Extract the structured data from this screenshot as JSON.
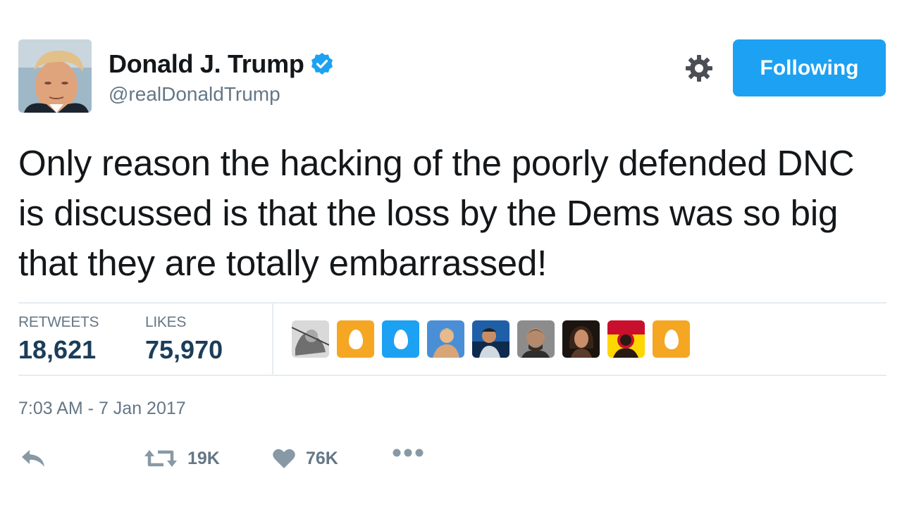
{
  "author": {
    "name": "Donald J. Trump",
    "handle": "@realDonaldTrump",
    "verified": true
  },
  "header": {
    "follow_button_label": "Following",
    "settings_icon": "gear-icon"
  },
  "tweet": {
    "text": "Only reason the hacking of the poorly defended DNC is discussed is that the loss by the Dems was so big that they are totally embarrassed!",
    "timestamp": "7:03 AM - 7 Jan 2017"
  },
  "stats": {
    "retweets_label": "RETWEETS",
    "retweets_value": "18,621",
    "likes_label": "LIKES",
    "likes_value": "75,970"
  },
  "likers": [
    {
      "type": "photo",
      "icon": "liker-avatar"
    },
    {
      "type": "egg",
      "color": "#f5a623"
    },
    {
      "type": "egg",
      "color": "#1da1f2"
    },
    {
      "type": "photo",
      "icon": "liker-avatar"
    },
    {
      "type": "photo",
      "icon": "liker-avatar"
    },
    {
      "type": "photo",
      "icon": "liker-avatar"
    },
    {
      "type": "photo",
      "icon": "liker-avatar"
    },
    {
      "type": "photo",
      "icon": "liker-avatar"
    },
    {
      "type": "egg",
      "color": "#f5a623"
    }
  ],
  "actions": {
    "reply_icon": "reply-icon",
    "retweet_count": "19K",
    "like_count": "76K",
    "more_icon": "more-icon"
  },
  "colors": {
    "accent": "#1da1f2",
    "secondary_text": "#657786",
    "stat_value": "#1b3d5a"
  }
}
